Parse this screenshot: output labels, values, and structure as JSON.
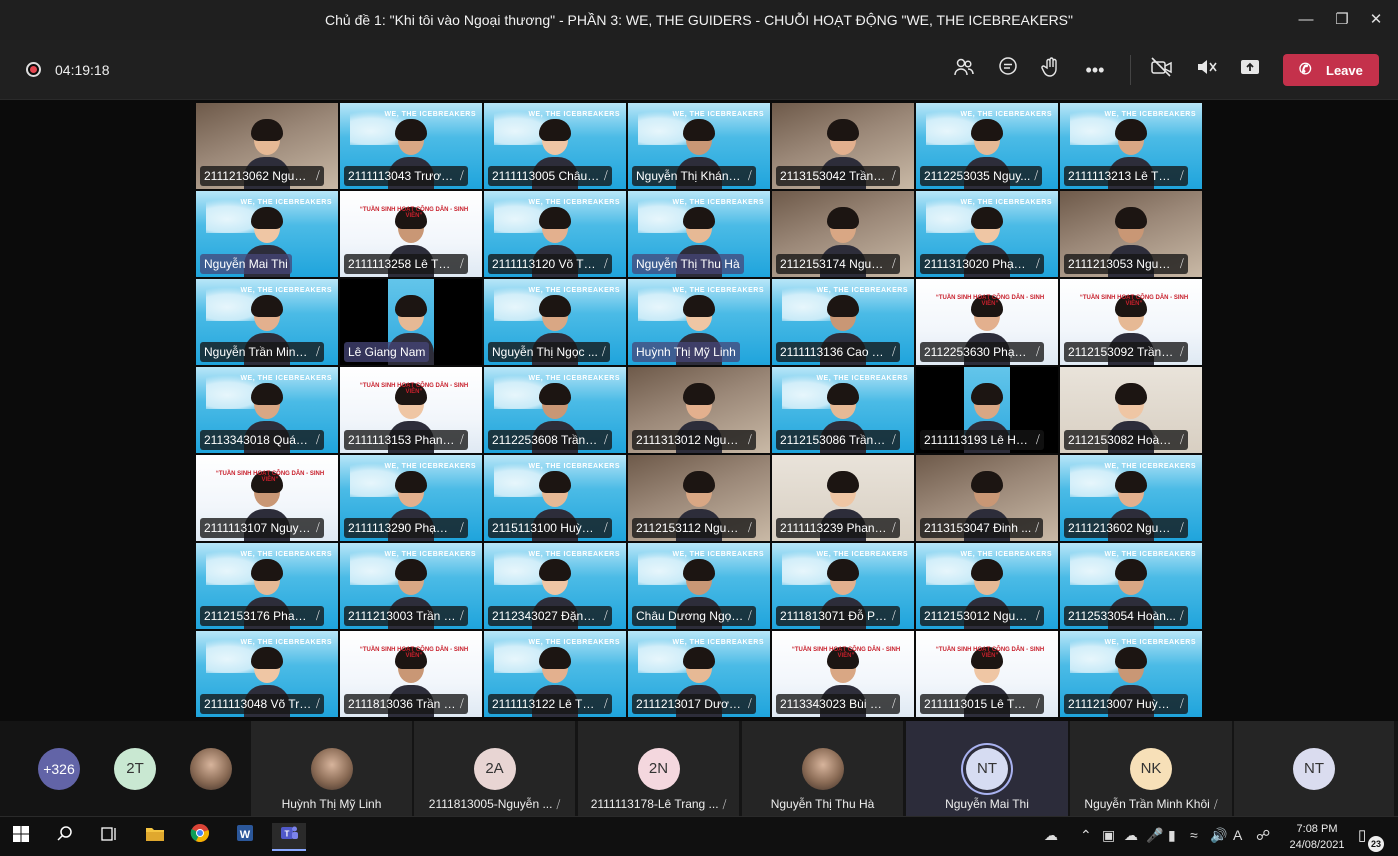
{
  "window": {
    "title": "Chủ đề 1: \"Khi tôi vào Ngoại thương\" - PHẦN 3: WE, THE GUIDERS - CHUỖI HOẠT ĐỘNG \"WE, THE ICEBREAKERS\"",
    "controls": [
      "minimize-icon",
      "restore-icon",
      "close-icon"
    ]
  },
  "toolbar": {
    "timer": "04:19:18",
    "icons": [
      "participants-icon",
      "chat-icon",
      "raise-hand-icon",
      "more-icon",
      "camera-off-icon",
      "mic-off-icon",
      "share-icon"
    ],
    "leave_label": "Leave",
    "leave_color": "#c4314b"
  },
  "grid": {
    "tiles": [
      {
        "name": "2111213062 Nguyễ...",
        "bg": "room",
        "muted": true
      },
      {
        "name": "2111113043 Trương...",
        "bg": "blue",
        "muted": true
      },
      {
        "name": "2111113005 Châu N...",
        "bg": "blue",
        "muted": true
      },
      {
        "name": "Nguyễn Thị Khánh...",
        "bg": "blue",
        "muted": true
      },
      {
        "name": "2113153042 Trần K...",
        "bg": "room",
        "muted": true
      },
      {
        "name": "2112253035 Nguy...",
        "bg": "blue",
        "muted": true
      },
      {
        "name": "2111113213 Lê Thị T...",
        "bg": "blue",
        "muted": true
      },
      {
        "name": "Nguyễn Mai Thi",
        "bg": "blue",
        "muted": false
      },
      {
        "name": "2111113258 Lê Thị ...",
        "bg": "white",
        "muted": true
      },
      {
        "name": "2111113120 Võ Tha...",
        "bg": "blue",
        "muted": true
      },
      {
        "name": "Nguyễn Thị Thu Hà",
        "bg": "blue",
        "muted": false
      },
      {
        "name": "2112153174 Nguyễ...",
        "bg": "room",
        "muted": true
      },
      {
        "name": "2111313020 Phạm ...",
        "bg": "blue",
        "muted": true
      },
      {
        "name": "2111213053 Nguyễ...",
        "bg": "room",
        "muted": true
      },
      {
        "name": "Nguyễn Trần Minh...",
        "bg": "blue",
        "muted": true
      },
      {
        "name": "Lê Giang Nam",
        "bg": "black",
        "muted": false
      },
      {
        "name": "Nguyễn Thị Ngọc ...",
        "bg": "blue",
        "muted": true
      },
      {
        "name": "Huỳnh Thị Mỹ Linh",
        "bg": "blue",
        "muted": false
      },
      {
        "name": "2111113136 Cao Th...",
        "bg": "blue",
        "muted": true
      },
      {
        "name": "2112253630 Phạm ...",
        "bg": "white",
        "muted": true
      },
      {
        "name": "2112153092 Trần N...",
        "bg": "white",
        "muted": true
      },
      {
        "name": "2113343018 Quách...",
        "bg": "blue",
        "muted": true
      },
      {
        "name": "2111113153 Phan Tr...",
        "bg": "white",
        "muted": true
      },
      {
        "name": "2112253608 Trần T...",
        "bg": "blue",
        "muted": true
      },
      {
        "name": "2111313012 Nguyễ...",
        "bg": "room",
        "muted": true
      },
      {
        "name": "2112153086 Trần G...",
        "bg": "blue",
        "muted": true
      },
      {
        "name": "2111113193 Lê Huỳ...",
        "bg": "black",
        "muted": true
      },
      {
        "name": "2112153082 Hoàng...",
        "bg": "beige",
        "muted": true
      },
      {
        "name": "2111113107 Nguyễ...",
        "bg": "white",
        "muted": true
      },
      {
        "name": "2111113290 Phạm ...",
        "bg": "blue",
        "muted": true
      },
      {
        "name": "2115113100 Huỳnh ...",
        "bg": "blue",
        "muted": true
      },
      {
        "name": "2112153112 Nguyễ...",
        "bg": "room",
        "muted": true
      },
      {
        "name": "2111113239 Phan N...",
        "bg": "beige",
        "muted": true
      },
      {
        "name": "2113153047 Đinh ...",
        "bg": "room",
        "muted": true
      },
      {
        "name": "2111213602 Nguyễ...",
        "bg": "blue",
        "muted": true
      },
      {
        "name": "2112153176 Phan V...",
        "bg": "blue",
        "muted": true
      },
      {
        "name": "2111213003 Trần N...",
        "bg": "blue",
        "muted": true
      },
      {
        "name": "2112343027 Đặng ...",
        "bg": "blue",
        "muted": true
      },
      {
        "name": "Châu Dương Ngọc...",
        "bg": "blue",
        "muted": true
      },
      {
        "name": "2111813071 Đỗ Phư...",
        "bg": "blue",
        "muted": true
      },
      {
        "name": "2112153012 Nguyễ...",
        "bg": "blue",
        "muted": true
      },
      {
        "name": "2112533054 Hoàn...",
        "bg": "blue",
        "muted": true
      },
      {
        "name": "2111113048 Võ Trà ...",
        "bg": "blue",
        "muted": true
      },
      {
        "name": "2111813036 Trần C...",
        "bg": "white",
        "muted": true
      },
      {
        "name": "2111113122 Lê Thị ...",
        "bg": "blue",
        "muted": true
      },
      {
        "name": "2111213017 Dương...",
        "bg": "blue",
        "muted": true
      },
      {
        "name": "2113343023 Bùi Gi...",
        "bg": "white",
        "muted": true
      },
      {
        "name": "2111113015 Lê Tuấn...",
        "bg": "white",
        "muted": true
      },
      {
        "name": "2111213007 Huỳnh ...",
        "bg": "blue",
        "muted": true
      }
    ]
  },
  "strip": [
    {
      "kind": "count",
      "label": "+326",
      "color": "#6264a7"
    },
    {
      "kind": "initials",
      "label": "2T",
      "color": "#c9e8d2"
    },
    {
      "kind": "photo",
      "label": ""
    },
    {
      "kind": "panel-photo",
      "name": "Huỳnh Thị Mỹ Linh",
      "muted": false
    },
    {
      "kind": "panel-initials",
      "initials": "2A",
      "color": "#e8d5d3",
      "name": "2111813005-Nguyễn ...",
      "muted": true
    },
    {
      "kind": "panel-initials",
      "initials": "2N",
      "color": "#f4d7de",
      "name": "2111113178-Lê Trang ...",
      "muted": true
    },
    {
      "kind": "panel-photo",
      "name": "Nguyễn Thị Thu Hà",
      "muted": false
    },
    {
      "kind": "panel-initials",
      "initials": "NT",
      "color": "#d6dcf2",
      "name": "Nguyễn Mai Thi",
      "muted": false,
      "active": true
    },
    {
      "kind": "panel-initials",
      "initials": "NK",
      "color": "#f7e0b8",
      "name": "Nguyễn Trần Minh Khôi",
      "muted": true
    },
    {
      "kind": "panel-initials",
      "initials": "NT",
      "color": "#dadcef",
      "name": "",
      "muted": false
    }
  ],
  "taskbar": {
    "apps": [
      "windows-start-icon",
      "search-icon",
      "task-view-icon",
      "file-explorer-icon",
      "chrome-icon",
      "word-icon",
      "teams-icon"
    ],
    "time": "7:08 PM",
    "date": "24/08/2021",
    "language": "A",
    "notifications": "23"
  }
}
